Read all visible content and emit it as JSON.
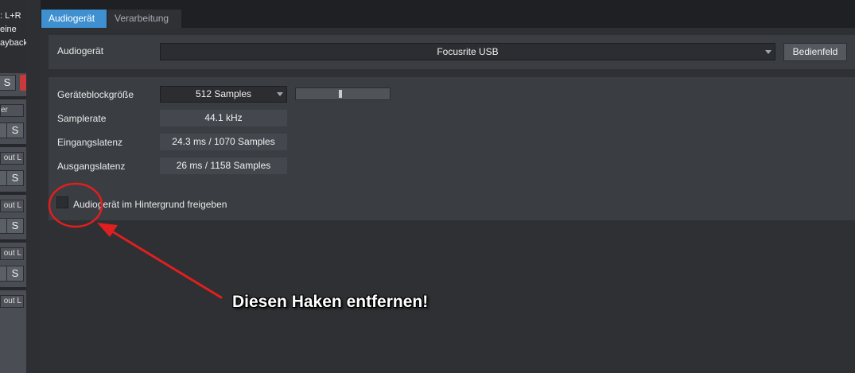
{
  "left_strip": {
    "channel_label": "L+R",
    "text_lines": [
      "eine",
      "ayback"
    ],
    "solo_label": "S",
    "partial_label": "er",
    "outputs": [
      "out L",
      "out L",
      "out L",
      "out L",
      "out L"
    ]
  },
  "tabs": [
    {
      "label": "Audiogerät",
      "active": true
    },
    {
      "label": "Verarbeitung",
      "active": false
    }
  ],
  "device": {
    "label": "Audiogerät",
    "value": "Focusrite USB",
    "control_panel_button": "Bedienfeld"
  },
  "settings": {
    "block_size_label": "Geräteblockgröße",
    "block_size_value": "512 Samples",
    "block_size_slider_fraction": 0.47,
    "samplerate_label": "Samplerate",
    "samplerate_value": "44.1 kHz",
    "input_latency_label": "Eingangslatenz",
    "input_latency_value": "24.3 ms / 1070 Samples",
    "output_latency_label": "Ausgangslatenz",
    "output_latency_value": "26 ms / 1158 Samples",
    "background_checkbox_label": "Audiogerät im Hintergrund freigeben",
    "background_checkbox_checked": false
  },
  "annotation": {
    "text": "Diesen Haken entfernen!",
    "color": "#e01f1f"
  }
}
